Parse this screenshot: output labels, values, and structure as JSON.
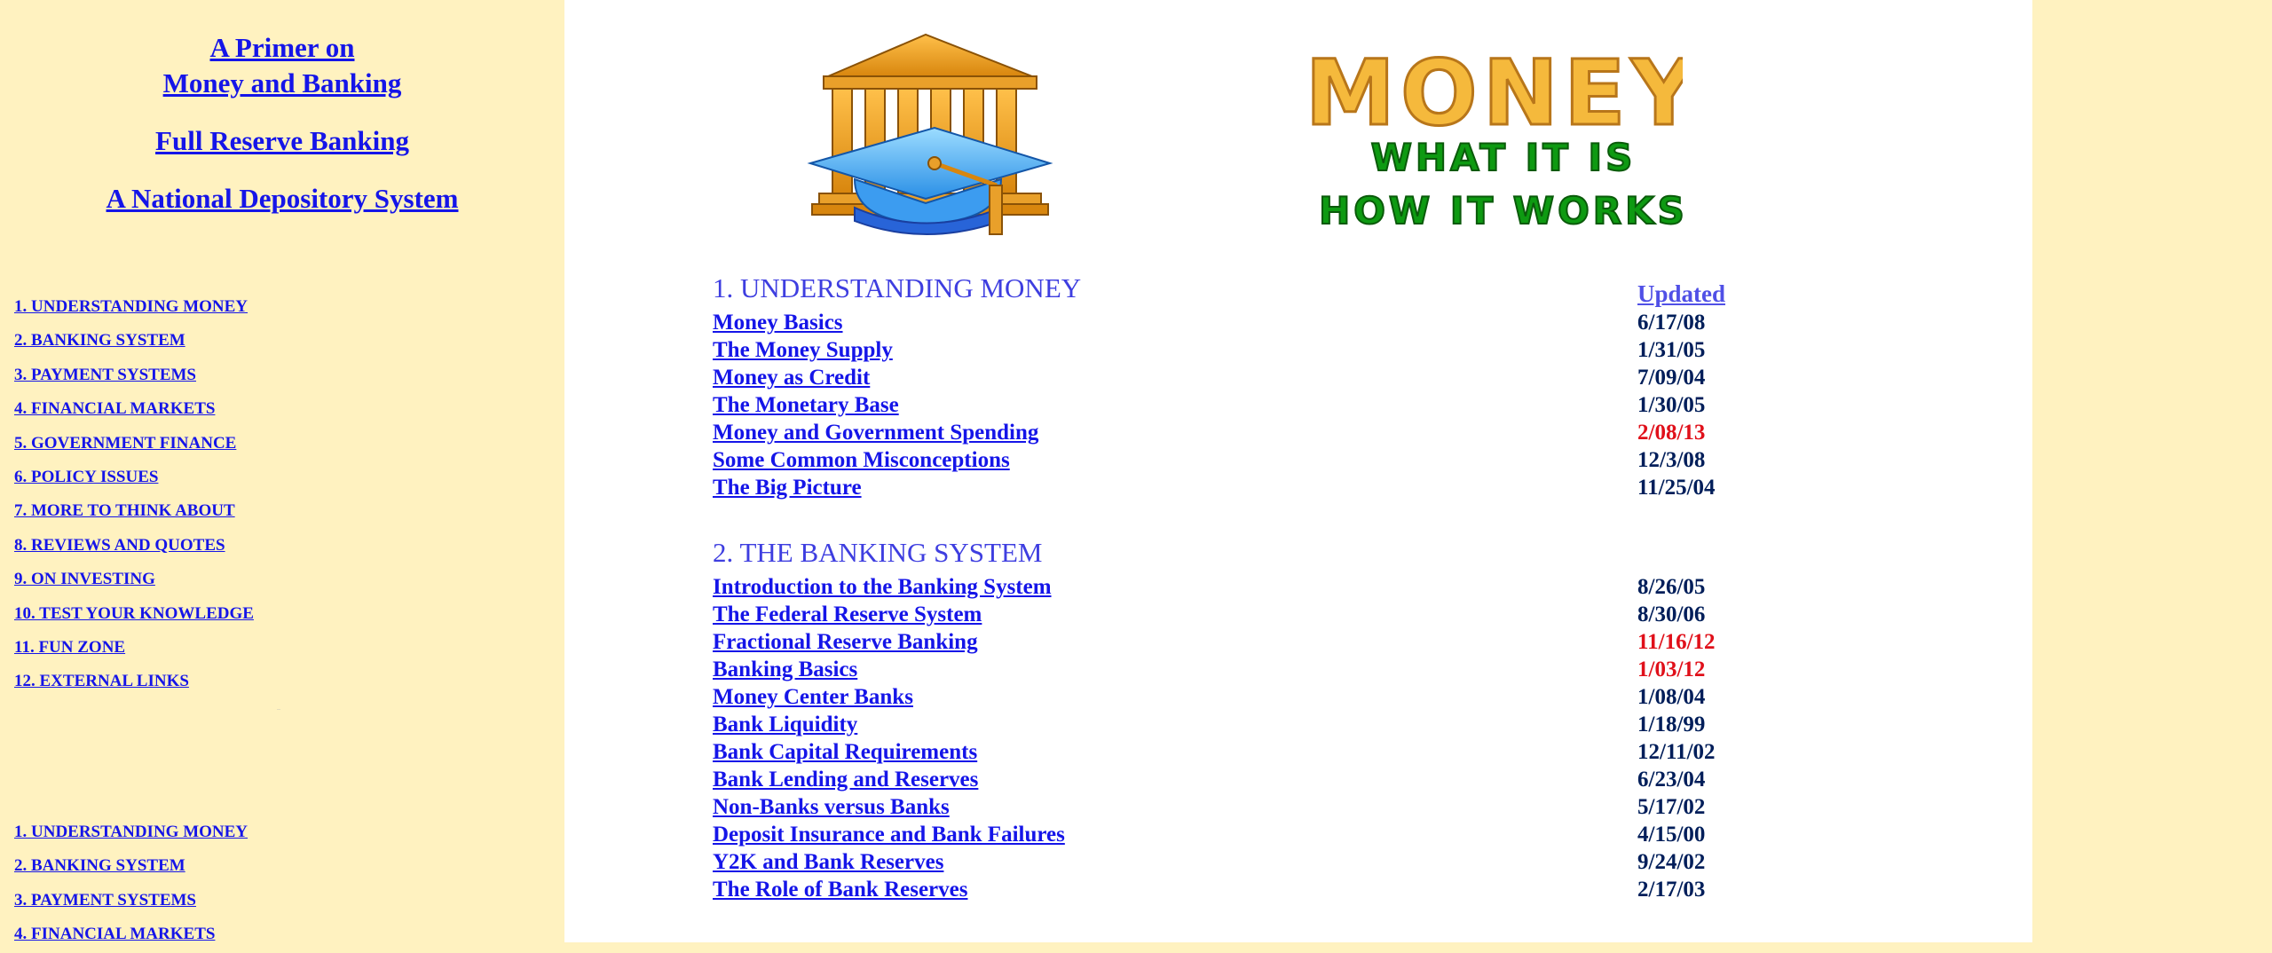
{
  "sidebar": {
    "primer_line1": " A Primer on",
    "primer_line2": "Money and Banking",
    "full_reserve": "Full Reserve Banking",
    "national_depository": "A National Depository System",
    "nav": [
      "1. UNDERSTANDING MONEY",
      "2. BANKING SYSTEM",
      "3. PAYMENT SYSTEMS",
      "4. FINANCIAL MARKETS",
      "5. GOVERNMENT FINANCE",
      "6. POLICY ISSUES",
      "7. MORE TO THINK ABOUT",
      "8. REVIEWS AND QUOTES",
      "9. ON INVESTING",
      "10. TEST YOUR KNOWLEDGE",
      "11. FUN ZONE",
      "12. EXTERNAL LINKS"
    ],
    "nav_repeat": [
      "1. UNDERSTANDING MONEY",
      "2. BANKING SYSTEM",
      "3. PAYMENT SYSTEMS",
      "4. FINANCIAL MARKETS"
    ],
    "dots": ".."
  },
  "header": {
    "title_logo": {
      "line1": "MONEY",
      "line2": "WHAT IT IS",
      "line3": "HOW IT WORKS",
      "colors": {
        "money": "#F5B93C",
        "money_outline": "#B8761A",
        "subtitle": "#0E9A12",
        "subtitle_outline": "#0A5A0A"
      }
    },
    "logo_icon": "bank-with-graduation-cap"
  },
  "updated_label": "Updated",
  "sections": [
    {
      "heading": "1. UNDERSTANDING MONEY",
      "items": [
        {
          "title": "Money Basics",
          "date": "6/17/08",
          "recent": false
        },
        {
          "title": "The Money Supply",
          "date": "1/31/05",
          "recent": false
        },
        {
          "title": "Money as Credit",
          "date": "7/09/04",
          "recent": false
        },
        {
          "title": "The Monetary Base",
          "date": "1/30/05",
          "recent": false
        },
        {
          "title": "Money and Government Spending",
          "date": "2/08/13",
          "recent": true
        },
        {
          "title": "Some Common Misconceptions",
          "date": "12/3/08",
          "recent": false
        },
        {
          "title": "The Big Picture",
          "date": "11/25/04",
          "recent": false
        }
      ]
    },
    {
      "heading": "2. THE BANKING SYSTEM",
      "items": [
        {
          "title": "Introduction to the Banking System",
          "date": "8/26/05",
          "recent": false
        },
        {
          "title": "The Federal Reserve System",
          "date": "8/30/06",
          "recent": false
        },
        {
          "title": "Fractional Reserve Banking",
          "date": "11/16/12",
          "recent": true
        },
        {
          "title": "Banking Basics",
          "date": "1/03/12",
          "recent": true
        },
        {
          "title": "Money Center Banks",
          "date": "1/08/04",
          "recent": false
        },
        {
          "title": "Bank Liquidity",
          "date": "1/18/99",
          "recent": false
        },
        {
          "title": "Bank Capital Requirements",
          "date": "12/11/02",
          "recent": false
        },
        {
          "title": "Bank Lending and Reserves",
          "date": "6/23/04",
          "recent": false
        },
        {
          "title": "Non-Banks versus Banks",
          "date": "5/17/02",
          "recent": false
        },
        {
          "title": "Deposit Insurance and Bank Failures",
          "date": "4/15/00",
          "recent": false
        },
        {
          "title": "Y2K and Bank Reserves",
          "date": "9/24/02",
          "recent": false
        },
        {
          "title": "The Role of Bank Reserves",
          "date": "2/17/03",
          "recent": false
        }
      ]
    }
  ],
  "colors": {
    "sidebar_bg": "#FFF2C0",
    "main_bg": "#FFFFFF",
    "link": "#1515E8",
    "date": "#001E5A",
    "date_recent": "#E0101A",
    "heading": "#3E3EE0"
  }
}
